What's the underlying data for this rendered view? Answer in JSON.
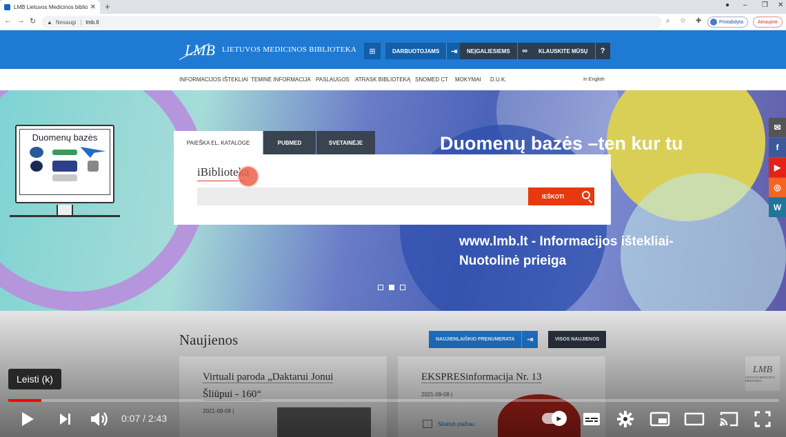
{
  "browser": {
    "tab_title": "LMB Lietuvos Medicinos bibliote",
    "tab_close": "✕",
    "new_tab": "+",
    "not_secure": "Nesaugi",
    "url": "lmb.lt",
    "profile_status": "Pristabdyta",
    "update_label": "Atnaujinti"
  },
  "site": {
    "logo_mark": "LMB",
    "logo_text": "LIETUVOS MEDICINOS BIBLIOTEKA",
    "buttons": {
      "staff": "DARBUOTOJAMS",
      "disabled": "NEĮGALIESIEMS",
      "ask": "KLAUSKITE MŪSŲ"
    },
    "menu": [
      "INFORMACIJOS IŠTEKLIAI",
      "TEMINĖ INFORMACIJA",
      "PASLAUGOS",
      "ATRASK BIBLIOTEKĄ",
      "SNOMED CT",
      "MOKYMAI",
      "D.U.K."
    ],
    "lang": "In English"
  },
  "hero": {
    "monitor_title": "Duomenų bazės",
    "tabs": [
      "PAIEŠKA EL. KATALOGE",
      "PUBMED",
      "SVETAINĖJE"
    ],
    "ibiblioteka": "iBiblioteka",
    "search_button": "IEŠKOTI",
    "headline": "Duomenų bazės –ten kur tu",
    "sub_line1": "www.lmb.lt - Informacijos ištekliai-",
    "sub_line2": "Nuotolinė prieiga",
    "slide_count": 3,
    "active_slide": 2
  },
  "news": {
    "title": "Naujienos",
    "subscribe": "NAUJIENLAIŠKIO PRENUMERATA",
    "all_news": "VISOS NAUJIENOS",
    "cards": [
      {
        "title_l1": "Virtuali paroda „Daktarui Jonui",
        "title_l2": "Šliūpui - 160“",
        "date": "2021-09-09 |"
      },
      {
        "title_l1": "EKSPRESinformacija Nr. 13",
        "date": "2021-09-08 |",
        "more": "Skaityti plačiau"
      }
    ]
  },
  "player": {
    "tooltip": "Leisti (k)",
    "current_time": "0:07",
    "duration": "2:43",
    "progress": 0.043,
    "time_sep": " / "
  },
  "colors": {
    "brand_blue": "#1f7ad3",
    "search_orange": "#e8380f",
    "progress_red": "#ff0000"
  }
}
